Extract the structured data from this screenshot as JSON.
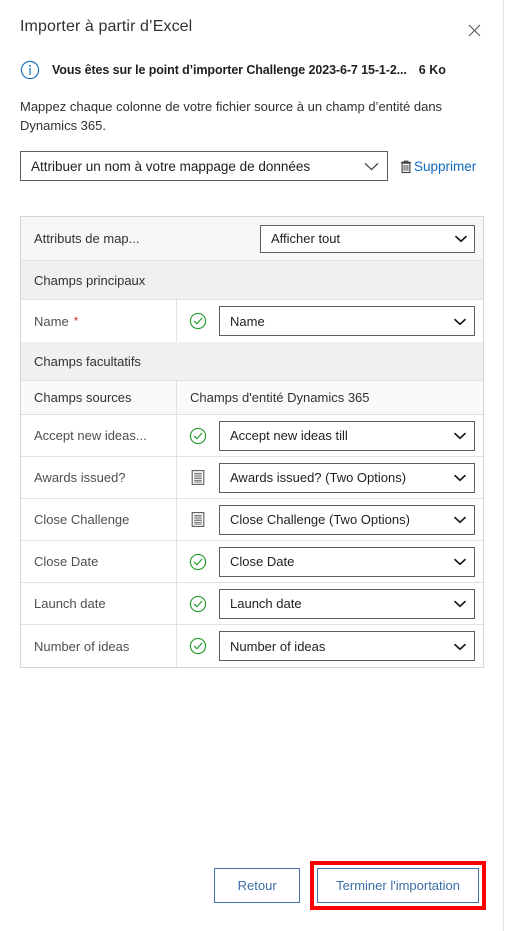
{
  "dialog": {
    "title": "Importer à partir d’Excel",
    "close_icon": "close-icon"
  },
  "info": {
    "icon": "info-circle-icon",
    "message": "Vous êtes sur le point d’importer Challenge 2023-6-7 15-1-2...",
    "file_size": "6 Ko"
  },
  "description": "Mappez chaque colonne de votre fichier source à un champ d’entité dans Dynamics 365.",
  "map_name": {
    "value": "Attribuer un nom à votre mappage de données",
    "chevron_icon": "chevron-down-icon",
    "delete_label": "Supprimer",
    "delete_icon": "trash-icon"
  },
  "table": {
    "attributes_label": "Attributs de map...",
    "attributes_filter_value": "Afficher tout",
    "section_required": "Champs principaux",
    "section_optional": "Champs facultatifs",
    "col_source_header": "Champs sources",
    "col_entity_header": "Champs d'entité Dynamics 365",
    "required_marker": "*",
    "required_rows": [
      {
        "source": "Name",
        "required": true,
        "status_icon": "check-circle-icon",
        "target": "Name"
      }
    ],
    "optional_rows": [
      {
        "source": "Accept new ideas...",
        "status_icon": "check-circle-icon",
        "target": "Accept new ideas till"
      },
      {
        "source": "Awards issued?",
        "status_icon": "two-options-icon",
        "target": "Awards issued? (Two Options)"
      },
      {
        "source": "Close Challenge",
        "status_icon": "two-options-icon",
        "target": "Close Challenge (Two Options)"
      },
      {
        "source": "Close Date",
        "status_icon": "check-circle-icon",
        "target": "Close Date"
      },
      {
        "source": "Launch date",
        "status_icon": "check-circle-icon",
        "target": "Launch date"
      },
      {
        "source": "Number of ideas",
        "status_icon": "check-circle-icon",
        "target": "Number of ideas"
      }
    ]
  },
  "footer": {
    "back_label": "Retour",
    "finish_label": "Terminer l'importation"
  },
  "colors": {
    "link": "#0f6cbd",
    "button_border": "#4371a7",
    "button_text": "#3b6da6",
    "highlight": "#ff0000",
    "success": "#107c10",
    "required": "#d13438",
    "info": "#0f6cbd"
  }
}
